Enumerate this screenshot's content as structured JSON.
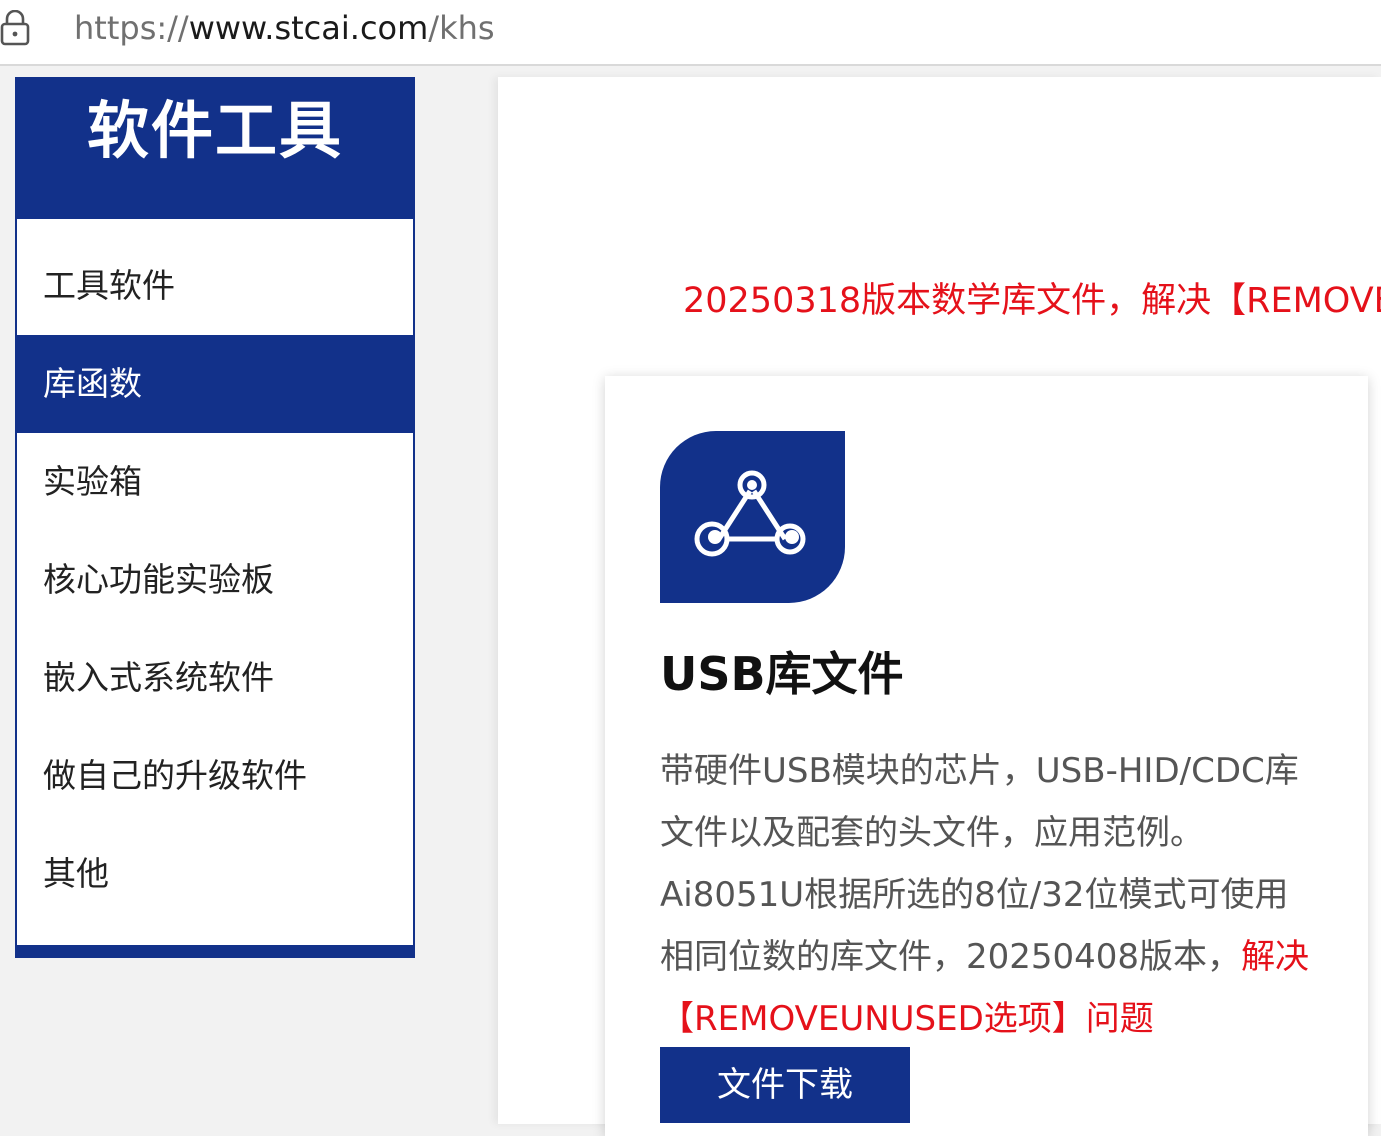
{
  "browser": {
    "url_scheme": "https://",
    "url_host": "www.stcai.com",
    "url_path": "/khs"
  },
  "sidebar": {
    "title": "软件工具",
    "items": [
      {
        "label": "工具软件",
        "active": false
      },
      {
        "label": "库函数",
        "active": true
      },
      {
        "label": "实验箱",
        "active": false
      },
      {
        "label": "核心功能实验板",
        "active": false
      },
      {
        "label": "嵌入式系统软件",
        "active": false
      },
      {
        "label": "做自己的升级软件",
        "active": false
      },
      {
        "label": "其他",
        "active": false
      }
    ]
  },
  "main": {
    "notice": "20250318版本数学库文件，解决【REMOVE",
    "card": {
      "icon": "share-nodes-icon",
      "title": "USB库文件",
      "description": "带硬件USB模块的芯片，USB-HID/CDC库文件以及配套的头文件，应用范例。Ai8051U根据所选的8位/32位模式可使用相同位数的库文件，20250408版本，",
      "description_highlight": "解决【REMOVEUNUSED选项】问题",
      "button_label": "文件下载"
    }
  },
  "colors": {
    "brand_blue": "#12318a",
    "alert_red": "#e5111a",
    "body_text": "#555555"
  }
}
